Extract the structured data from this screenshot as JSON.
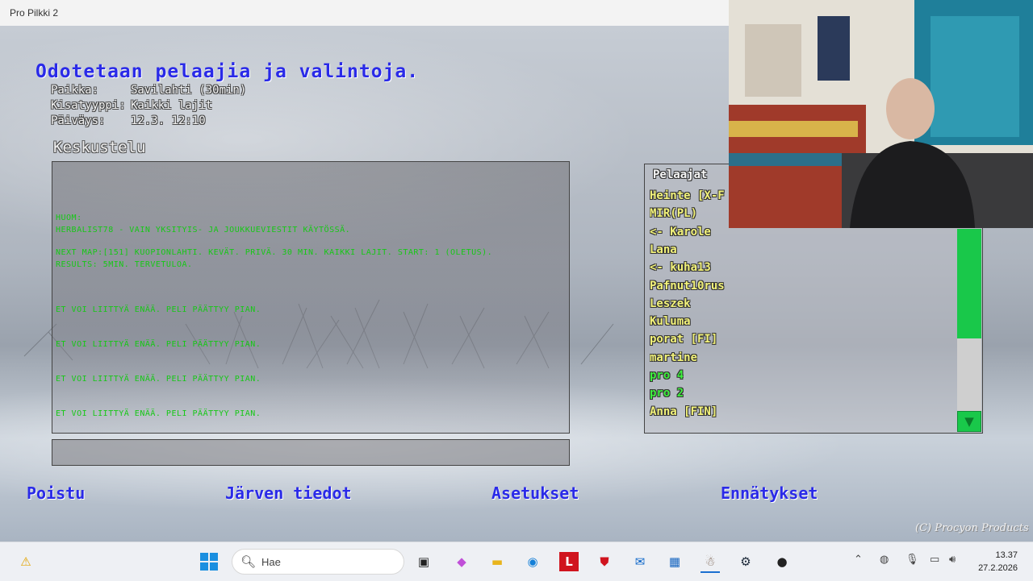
{
  "window": {
    "title": "Pro Pilkki 2"
  },
  "lobby": {
    "heading": "Odotetaan pelaajia ja valintoja.",
    "info": [
      {
        "key": "Paikka:",
        "value": "Savilahti (30min)"
      },
      {
        "key": "Kisatyyppi:",
        "value": "Kaikki lajit"
      },
      {
        "key": "Päiväys:",
        "value": "12.3. 12:10"
      }
    ]
  },
  "chat": {
    "title": "Keskustelu",
    "lines": [
      "HUOM:",
      "HERBALIST78 - VAIN YKSITYIS- JA JOUKKUEVIESTIT KÄYTÖSSÄ.",
      "NEXT MAP:[151] KUOPIONLAHTI. KEVÄT. PRIVÄ. 30 MIN. KAIKKI LAJIT. START: 1 (OLETUS).",
      "RESULTS: 5MIN. TERVETULOA.",
      "ET VOI LIITTYÄ ENÄÄ. PELI PÄÄTTYY PIAN.",
      "ET VOI LIITTYÄ ENÄÄ. PELI PÄÄTTYY PIAN.",
      "ET VOI LIITTYÄ ENÄÄ. PELI PÄÄTTYY PIAN.",
      "ET VOI LIITTYÄ ENÄÄ. PELI PÄÄTTYY PIAN."
    ],
    "input_value": ""
  },
  "players": {
    "header": "Pelaajat",
    "items": [
      {
        "name": "Heinte [X-F",
        "color": "#f2f27a"
      },
      {
        "name": "MIR(PL)",
        "color": "#f2f27a"
      },
      {
        "name": "<- Karole",
        "color": "#f2f27a"
      },
      {
        "name": "Lana",
        "color": "#f2f27a"
      },
      {
        "name": "<- kuha13",
        "color": "#f2f27a"
      },
      {
        "name": "Pafnut10rus",
        "color": "#f2f27a"
      },
      {
        "name": "Leszek",
        "color": "#f2f27a"
      },
      {
        "name": "Kuluma",
        "color": "#f2f27a"
      },
      {
        "name": "porat [FI]",
        "color": "#f2f27a"
      },
      {
        "name": "martine",
        "color": "#f2f27a"
      },
      {
        "name": "pro 4",
        "color": "#3ef03e"
      },
      {
        "name": "pro 2",
        "color": "#3ef03e"
      },
      {
        "name": "Anna [FIN]",
        "color": "#f2f27a"
      }
    ],
    "scroll_down_icon": "triangle-down-icon"
  },
  "menu": {
    "exit": "Poistu",
    "lake_info": "Järven tiedot",
    "settings": "Asetukset",
    "records": "Ennätykset"
  },
  "copyright": "(C) Procyon Products",
  "taskbar": {
    "search_placeholder": "Hae",
    "time": "13.37",
    "date": "27.2.2026"
  },
  "colors": {
    "heading": "#2a2ae8",
    "chat_text": "#16c816",
    "scroll": "#19c84a"
  }
}
